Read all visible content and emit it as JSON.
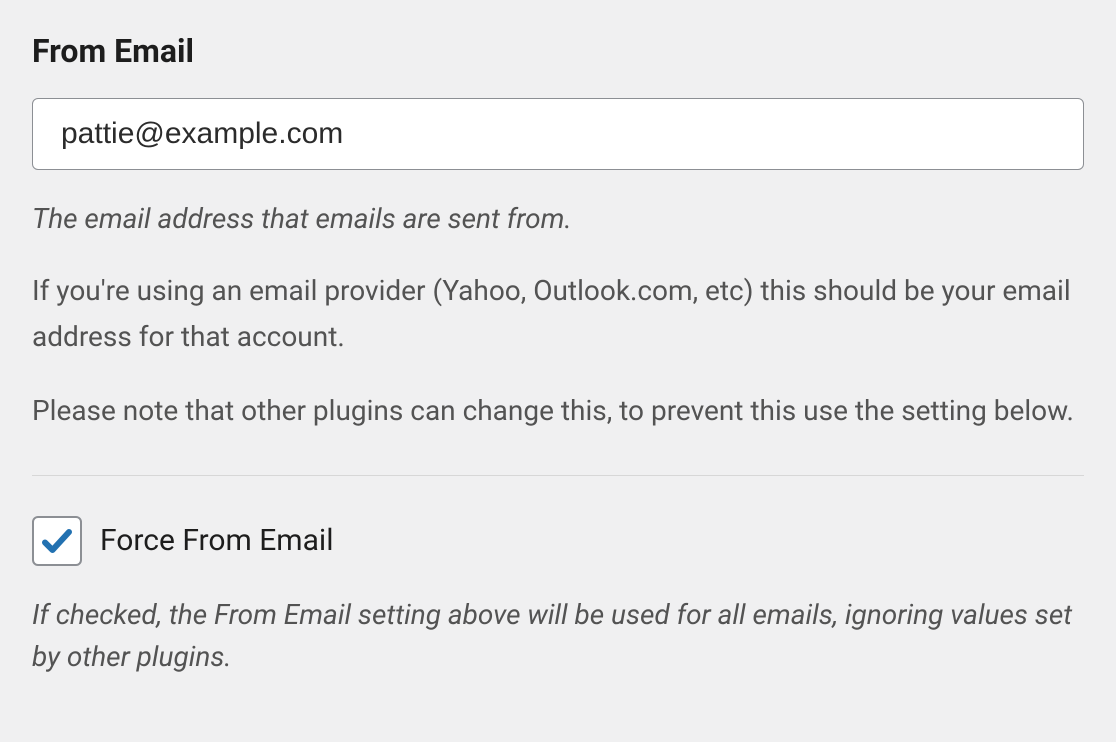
{
  "from_email": {
    "heading": "From Email",
    "value": "pattie@example.com",
    "description": "The email address that emails are sent from.",
    "provider_note": "If you're using an email provider (Yahoo, Outlook.com, etc) this should be your email address for that account.",
    "plugin_note": "Please note that other plugins can change this, to prevent this use the setting below."
  },
  "force_from_email": {
    "label": "Force From Email",
    "checked": true,
    "description": "If checked, the From Email setting above will be used for all emails, ignoring values set by other plugins."
  }
}
